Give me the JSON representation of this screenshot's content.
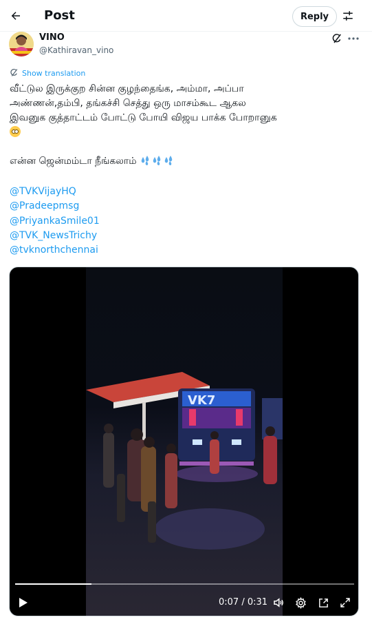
{
  "header": {
    "title": "Post",
    "reply_label": "Reply"
  },
  "author": {
    "display_name": "VINO",
    "handle": "@Kathiravan_vino"
  },
  "translate_label": "Show translation",
  "tweet": {
    "line1": "வீட்டுல இருக்குற சின்ன குழந்தைங்க, அம்மா, அப்பா",
    "line2": "அண்ணன்,தம்பி, தங்கச்சி செத்து ஒரு மாசம்கூட ஆகல",
    "line3": "இவனுக குத்தாட்டம் போட்டு போயி விஜய பாக்க போறானுக",
    "line4": "என்ன ஜென்மம்டா நீங்கலாம்"
  },
  "mentions": [
    "@TVKVijayHQ",
    "@Pradeepmsg",
    "@PriyankaSmile01",
    "@TVK_NewsTrichy",
    "@tvknorthchennai"
  ],
  "video": {
    "time_display": "0:07 / 0:31",
    "progress": 0.2258
  },
  "icons": {
    "back": "arrow-left-icon",
    "settings": "sliders-icon",
    "grok": "grok-icon",
    "more": "more-dots-icon",
    "translate": "globe-icon",
    "play": "play-icon",
    "volume": "volume-icon",
    "video_settings": "gear-icon",
    "pip": "pip-icon",
    "fullscreen": "fullscreen-icon"
  },
  "colors": {
    "accent": "#1d9bf0",
    "text": "#0f1419",
    "muted": "#536471"
  }
}
